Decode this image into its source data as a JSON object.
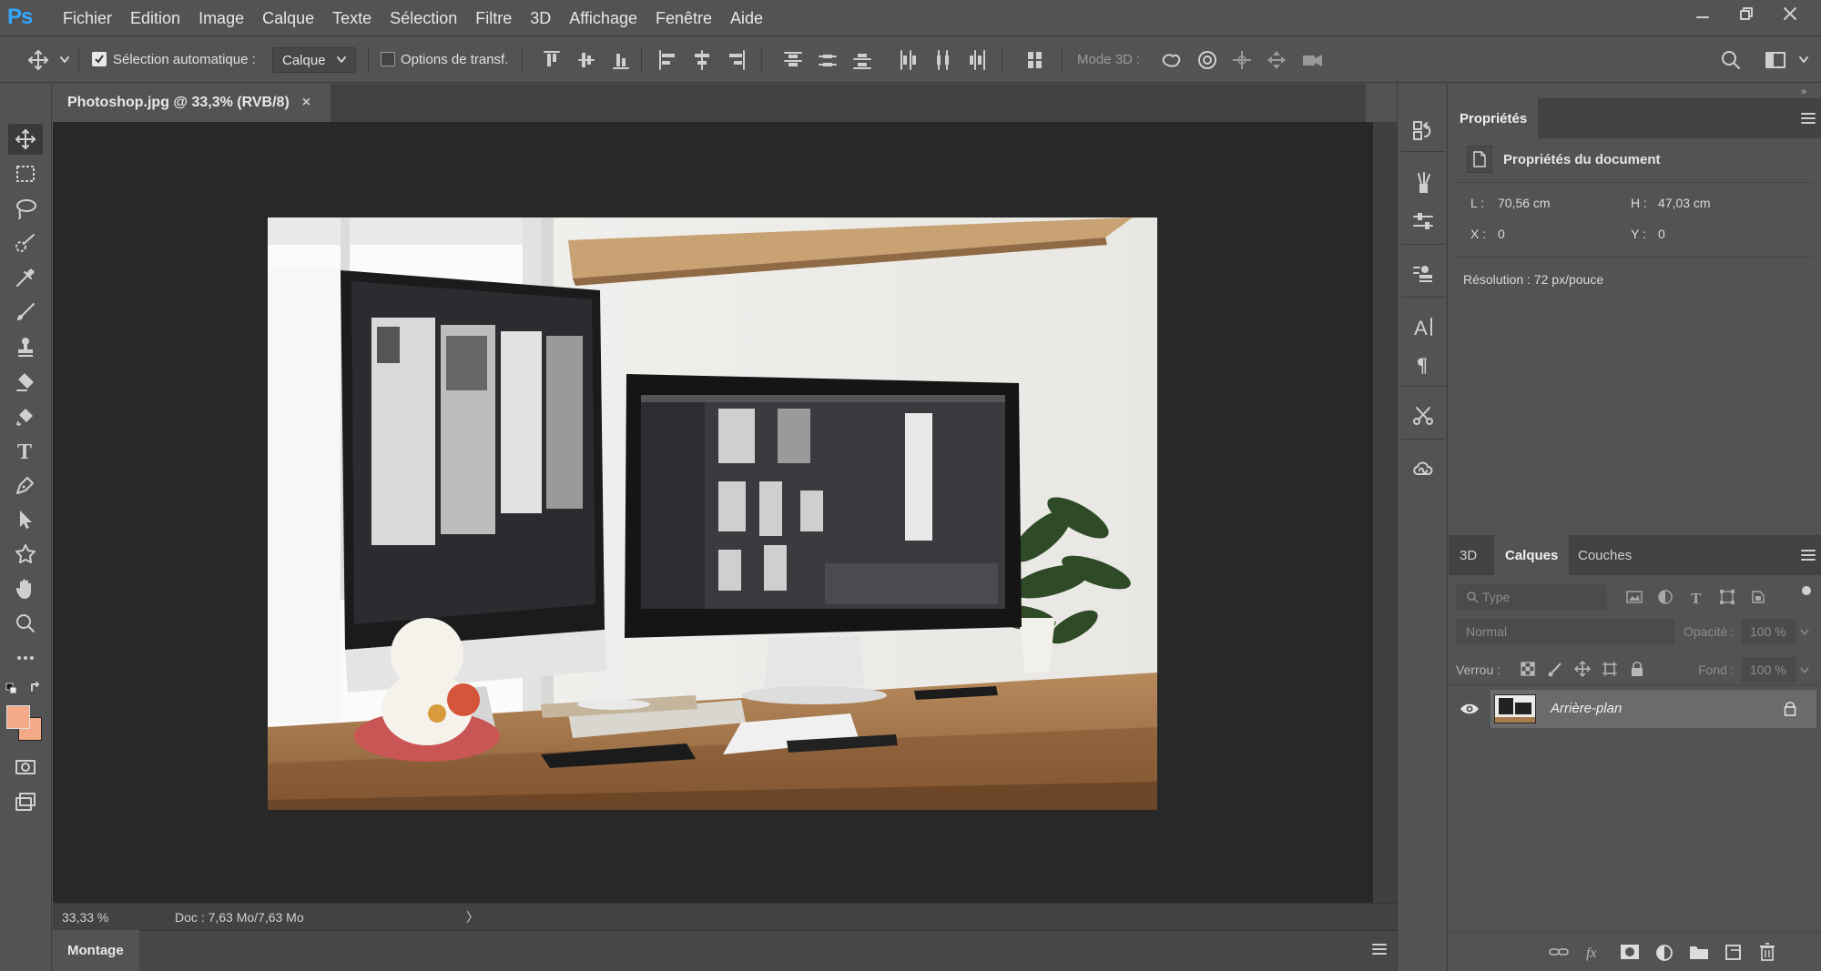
{
  "app": {
    "logo": "Ps",
    "brand_color": "#31a8ff"
  },
  "menu": [
    "Fichier",
    "Edition",
    "Image",
    "Calque",
    "Texte",
    "Sélection",
    "Filtre",
    "3D",
    "Affichage",
    "Fenêtre",
    "Aide"
  ],
  "options": {
    "auto_select_label": "Sélection automatique :",
    "auto_select_checked": true,
    "auto_select_target": "Calque",
    "transform_label": "Options de transf.",
    "mode3d_label": "Mode 3D :"
  },
  "document": {
    "tab_title": "Photoshop.jpg @ 33,3% (RVB/8)",
    "close_glyph": "×",
    "zoom": "33,33 %",
    "doc_info": "Doc : 7,63 Mo/7,63 Mo",
    "status_arrow": "〉"
  },
  "bottom_panel": {
    "tab": "Montage"
  },
  "properties": {
    "tab": "Propriétés",
    "section": "Propriétés du document",
    "width_label": "L :",
    "width_value": "70,56 cm",
    "height_label": "H :",
    "height_value": "47,03 cm",
    "x_label": "X :",
    "x_value": "0",
    "y_label": "Y :",
    "y_value": "0",
    "resolution": "Résolution : 72 px/pouce"
  },
  "layers_panel": {
    "tabs": [
      "3D",
      "Calques",
      "Couches"
    ],
    "active_tab": "Calques",
    "filter_placeholder": "Type",
    "blend_mode": "Normal",
    "opacity_label": "Opacité :",
    "opacity_value": "100 %",
    "lock_label": "Verrou :",
    "fill_label": "Fond :",
    "fill_value": "100 %",
    "layers": [
      {
        "name": "Arrière-plan",
        "visible": true,
        "locked": true
      }
    ]
  },
  "colors": {
    "foreground": "#f4a987",
    "background": "#f4a987"
  }
}
